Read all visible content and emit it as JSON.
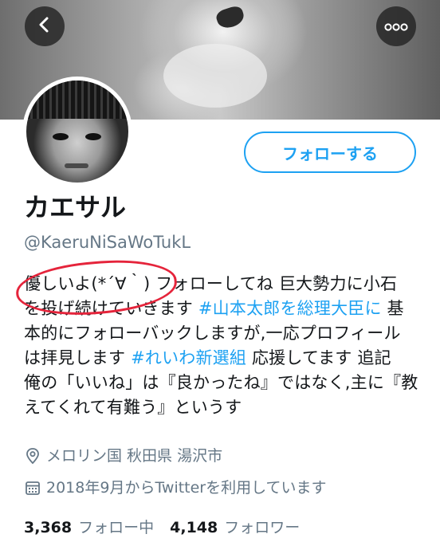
{
  "profile": {
    "name": "カエサル",
    "handle": "@KaeruNiSaWoTukL",
    "follow_label": "フォローする",
    "bio_lines": [
      [
        "優しいよ(*´∀｀) フォローしてね 巨大勢力に小石"
      ],
      [
        "を投げ続けていきます ",
        "#山本太郎を総理大臣に",
        " 基"
      ],
      [
        "本的にフォローバックしますが,一応プロフィール"
      ],
      [
        "は拝見します ",
        "#れいわ新選組",
        " 応援してます 追記"
      ],
      [
        "俺の「いいね」は『良かったね』ではなく,主に『教"
      ],
      [
        "えてくれて有難う』というす"
      ]
    ],
    "location": "メロリン国 秋田県 湯沢市",
    "joined": "2018年9月からTwitterを利用しています",
    "following_count": "3,368",
    "following_label": "フォロー中",
    "followers_count": "4,148",
    "followers_label": "フォロワー"
  },
  "icons": {
    "back": "chevron-left-icon",
    "more": "more-dots-icon",
    "location": "location-pin-icon",
    "calendar": "calendar-icon"
  },
  "colors": {
    "accent": "#1da1f2",
    "secondary_text": "#657786",
    "annotation": "#e5243b"
  }
}
